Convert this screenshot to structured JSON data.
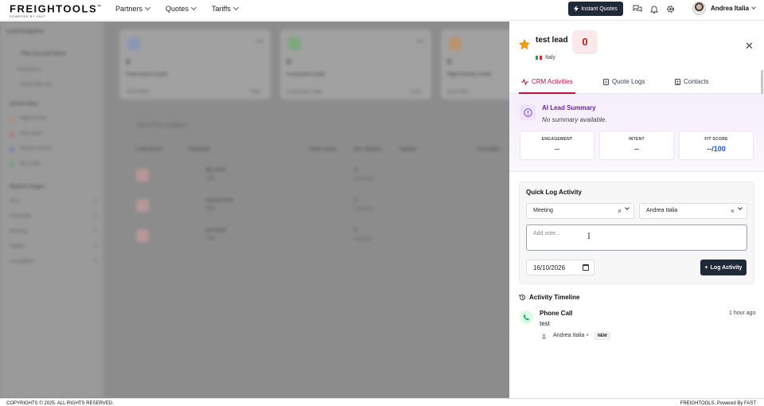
{
  "app": {
    "brand": "FREIGHTOOLS",
    "powered": "POWERED BY FAST"
  },
  "nav": [
    {
      "label": "Partners"
    },
    {
      "label": "Quotes"
    },
    {
      "label": "Tariffs"
    }
  ],
  "header": {
    "instant_quotes": "Instant Quotes",
    "user_name": "Andrea Italia"
  },
  "background": {
    "sidebar_title": "Lead Navigation",
    "filter": "Filter by Lead Name",
    "all_owners": "All Owners",
    "owner_toggle": "HAVE ME LVE",
    "saved_views_title": "Saved Views",
    "views": [
      "High Priority",
      "Hot Leads",
      "Recent Activity",
      "My Leads"
    ],
    "pipeline_title": "Pipeline Stages",
    "stages": [
      {
        "label": "New",
        "count": "0"
      },
      {
        "label": "Contacted",
        "count": "0"
      },
      {
        "label": "Working",
        "count": "0"
      },
      {
        "label": "Stalled",
        "count": "0"
      },
      {
        "label": "Unqualified",
        "count": "0"
      }
    ],
    "cards": [
      {
        "value": "0",
        "label": "Total Active Leads",
        "pct": "0%",
        "foot": "This Month",
        "foot_r": "Filter"
      },
      {
        "value": "0",
        "label": "Converted Leads",
        "pct": "0%",
        "foot": "Conversion Rate",
        "foot_r": "0.0%"
      },
      {
        "value": "0",
        "label": "High Priority Leads",
        "pct": "",
        "foot": "Score 80+",
        "foot_r": ""
      }
    ],
    "search_placeholder": "Search by company...",
    "columns": [
      "Lead Score",
      "Company",
      "Trade Lanes",
      "Est. Volume",
      "Signals",
      "AI Insight"
    ],
    "rows": [
      {
        "score": "0",
        "company": "My Lead",
        "country": "Italy",
        "volume": "0",
        "vol_sub": "0 annual"
      },
      {
        "score": "0",
        "company": "newest lead",
        "country": "Italy",
        "volume": "0",
        "vol_sub": "0 annual"
      },
      {
        "score": "0",
        "company": "test lead",
        "country": "Italy",
        "volume": "0",
        "vol_sub": "0 annual"
      }
    ]
  },
  "panel": {
    "title": "test lead",
    "score": "0",
    "country": "Italy",
    "tabs": [
      {
        "label": "CRM Activities",
        "active": true
      },
      {
        "label": "Quote Logs",
        "active": false
      },
      {
        "label": "Contacts",
        "active": false
      }
    ],
    "ai_summary": {
      "title": "AI Lead Summary",
      "text": "No summary available."
    },
    "metrics": [
      {
        "label": "ENGAGEMENT",
        "value": "--",
        "color": "#15803d"
      },
      {
        "label": "INTENT",
        "value": "--",
        "color": "#be123c"
      },
      {
        "label": "FIT SCORE",
        "value": "--/100",
        "color": "#1d4ed8"
      }
    ],
    "quick_log": {
      "title": "Quick Log Activity",
      "type": "Meeting",
      "user": "Andrea Italia",
      "note_placeholder": "Add note...",
      "date": "16/10/2026",
      "button": "Log Activity"
    },
    "timeline": {
      "title": "Activity Timeline",
      "items": [
        {
          "title": "Phone Call",
          "time": "1 hour ago",
          "note": "test",
          "user": "Andrea Italia",
          "badge": "NEW"
        }
      ]
    }
  },
  "footer": {
    "left": "COPYRIGHTS © 2025. ALL RIGHTS RESERVED.",
    "right": "FREIGHTOOLS. Powered By FAST"
  },
  "colors": {
    "accent": "#be123c",
    "dark_button": "#1f2937",
    "ai_purple": "#6b21a8"
  }
}
